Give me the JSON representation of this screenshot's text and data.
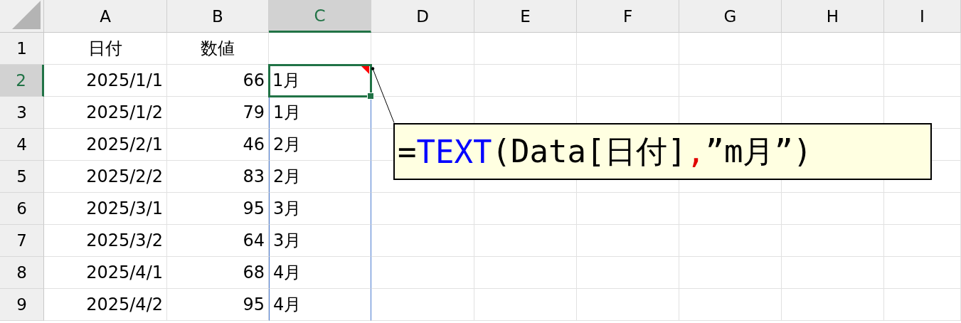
{
  "columns": [
    {
      "label": "A",
      "selected": false
    },
    {
      "label": "B",
      "selected": false
    },
    {
      "label": "C",
      "selected": true
    },
    {
      "label": "D",
      "selected": false
    },
    {
      "label": "E",
      "selected": false
    },
    {
      "label": "F",
      "selected": false
    },
    {
      "label": "G",
      "selected": false
    },
    {
      "label": "H",
      "selected": false
    },
    {
      "label": "I",
      "selected": false
    }
  ],
  "rows": [
    {
      "number": "1",
      "selected": false,
      "kind": "header",
      "a": "日付",
      "b": "数値"
    },
    {
      "number": "2",
      "selected": true,
      "kind": "data",
      "a": "2025/1/1",
      "b": "66",
      "c": "1月",
      "comment": true
    },
    {
      "number": "3",
      "selected": false,
      "kind": "data",
      "a": "2025/1/2",
      "b": "79",
      "c": "1月",
      "comment": false
    },
    {
      "number": "4",
      "selected": false,
      "kind": "data",
      "a": "2025/2/1",
      "b": "46",
      "c": "2月",
      "comment": false
    },
    {
      "number": "5",
      "selected": false,
      "kind": "data",
      "a": "2025/2/2",
      "b": "83",
      "c": "2月",
      "comment": false
    },
    {
      "number": "6",
      "selected": false,
      "kind": "data",
      "a": "2025/3/1",
      "b": "95",
      "c": "3月",
      "comment": false
    },
    {
      "number": "7",
      "selected": false,
      "kind": "data",
      "a": "2025/3/2",
      "b": "64",
      "c": "3月",
      "comment": false
    },
    {
      "number": "8",
      "selected": false,
      "kind": "data",
      "a": "2025/4/1",
      "b": "68",
      "c": "4月",
      "comment": false
    },
    {
      "number": "9",
      "selected": false,
      "kind": "data",
      "a": "2025/4/2",
      "b": "95",
      "c": "4月",
      "comment": false
    }
  ],
  "callout": {
    "parts": [
      {
        "text": "=",
        "kind": "plain"
      },
      {
        "text": "TEXT",
        "kind": "function"
      },
      {
        "text": "(Data[日付]",
        "kind": "plain"
      },
      {
        "text": ",",
        "kind": "separator"
      },
      {
        "text": "”m月”)",
        "kind": "plain"
      }
    ]
  }
}
